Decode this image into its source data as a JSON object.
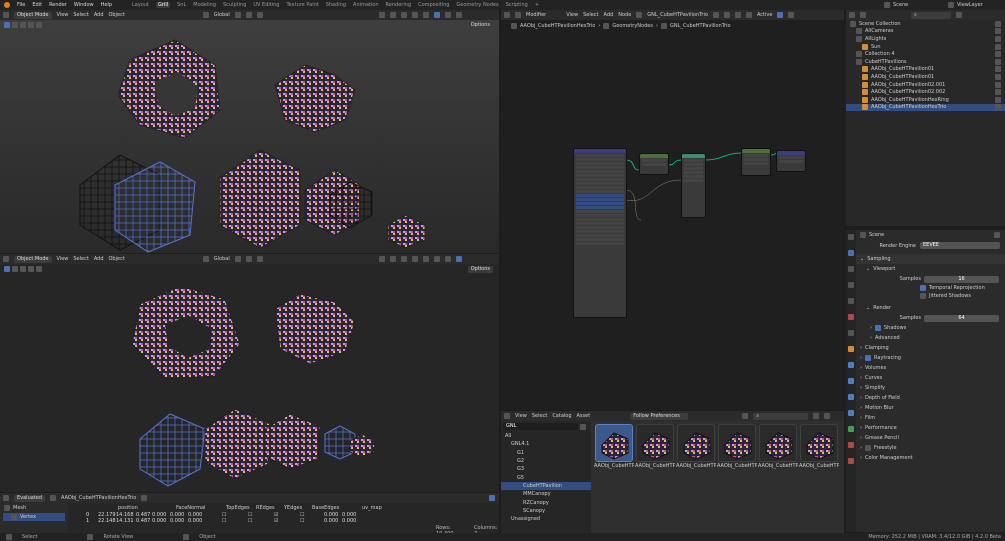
{
  "topbar": {
    "menus": [
      "File",
      "Edit",
      "Render",
      "Window",
      "Help"
    ],
    "workspaces": [
      "Layout",
      "Grill",
      "SnL",
      "Modeling",
      "Sculpting",
      "UV Editing",
      "Texture Paint",
      "Shading",
      "Animation",
      "Rendering",
      "Compositing",
      "Geometry Nodes",
      "Scripting"
    ],
    "active_workspace": "Grill",
    "scene": "Scene",
    "view_layer": "ViewLayer"
  },
  "viewport_top": {
    "mode": "Object Mode",
    "menus": [
      "View",
      "Select",
      "Add",
      "Object"
    ],
    "orientation": "Global",
    "options": "Options"
  },
  "viewport_bottom": {
    "mode": "Object Mode",
    "menus": [
      "View",
      "Select",
      "Add",
      "Object"
    ],
    "orientation": "Global",
    "options": "Options"
  },
  "node_editor": {
    "editor": "Modifier",
    "menus": [
      "View",
      "Select",
      "Add",
      "Node"
    ],
    "node_group": "GNL_CubeHTPavilionTrio",
    "active": "Active",
    "breadcrumb": [
      "AAObj_CubeHTPavilionHexTrio",
      "GeometryNodes",
      "GNL_CubeHTPavilionTrio"
    ],
    "wire_color": "#00d69d"
  },
  "outliner": {
    "rows": [
      {
        "label": "Scene Collection",
        "indent": 0,
        "sel": false
      },
      {
        "label": "AllCameras",
        "indent": 1,
        "sel": false
      },
      {
        "label": "AllLights",
        "indent": 1,
        "sel": false
      },
      {
        "label": "Sun",
        "indent": 2,
        "sel": false
      },
      {
        "label": "Collection 4",
        "indent": 1,
        "sel": false
      },
      {
        "label": "CubeHTPavilions",
        "indent": 1,
        "sel": false
      },
      {
        "label": "AAObj_CubeHTPavilion01",
        "indent": 2,
        "sel": false
      },
      {
        "label": "AAObj_CubeHTPavilion01",
        "indent": 2,
        "sel": false
      },
      {
        "label": "AAObj_CubeHTPavilion02.001",
        "indent": 2,
        "sel": false
      },
      {
        "label": "AAObj_CubeHTPavilion02.002",
        "indent": 2,
        "sel": false
      },
      {
        "label": "AAObj_CubeHTPavilionHexRing",
        "indent": 2,
        "sel": false
      },
      {
        "label": "AAObj_CubeHTPavilionHexTrio",
        "indent": 2,
        "sel": true
      }
    ]
  },
  "properties": {
    "title": "Scene",
    "render_engine_label": "Render Engine",
    "render_engine": "EEVEE",
    "sampling": "Sampling",
    "viewport": "Viewport",
    "samples_label": "Samples",
    "viewport_samples": "16",
    "temporal_reprojection": "Temporal Reprojection",
    "jittered_shadows": "Jittered Shadows",
    "render": "Render",
    "render_samples": "64",
    "sections": [
      "Shadows",
      "Advanced",
      "Clamping",
      "Raytracing",
      "Volumes",
      "Curves",
      "Simplify",
      "Depth of Field",
      "Motion Blur",
      "Film",
      "Performance",
      "Grease Pencil",
      "Freestyle",
      "Color Management"
    ]
  },
  "asset_browser": {
    "menus": [
      "View",
      "Select",
      "Catalog",
      "Asset"
    ],
    "filter": "Follow Preferences",
    "search_value": "GNL",
    "tree": [
      {
        "label": "All",
        "indent": 0,
        "sel": false
      },
      {
        "label": "GNL4.1",
        "indent": 1,
        "sel": false
      },
      {
        "label": "G1",
        "indent": 2,
        "sel": false
      },
      {
        "label": "G2",
        "indent": 2,
        "sel": false
      },
      {
        "label": "G3",
        "indent": 2,
        "sel": false
      },
      {
        "label": "G5",
        "indent": 2,
        "sel": false
      },
      {
        "label": "CubeHTPavilion",
        "indent": 3,
        "sel": true
      },
      {
        "label": "MMCanopy",
        "indent": 3,
        "sel": false
      },
      {
        "label": "RZCanopy",
        "indent": 3,
        "sel": false
      },
      {
        "label": "SCanopy",
        "indent": 3,
        "sel": false
      },
      {
        "label": "Unassigned",
        "indent": 1,
        "sel": false
      }
    ],
    "assets": [
      "AAObj_CubeHTP...",
      "AAObj_CubeHTP...",
      "AAObj_CubeHTP...",
      "AAObj_CubeHTP...",
      "AAObj_CubeHTP...",
      "AAObj_CubeHTP..."
    ]
  },
  "spreadsheet": {
    "mode": "Evaluated",
    "object": "AAObj_CubeHTPavilionHexTrio",
    "mesh": "Mesh",
    "vertex": "Vertex",
    "columns": [
      "position",
      "FaceNormal",
      "TopEdges",
      "REdges",
      "YEdges",
      "BaseEdges",
      "uv_map"
    ],
    "rows": [
      [
        "0",
        "22.179",
        "14.168",
        "0.487",
        "0.000",
        "0.000",
        "0.000",
        "",
        "",
        "",
        "",
        "0.000",
        "0.000"
      ],
      [
        "1",
        "22.148",
        "14.131",
        "0.487",
        "0.000",
        "0.000",
        "0.000",
        "",
        "",
        "",
        "",
        "0.000",
        "0.000"
      ]
    ],
    "rows_label": "Rows: 10,400",
    "cols_label": "Columns: 7"
  },
  "status": {
    "left": [
      "Select",
      "Rotate View",
      "Object"
    ],
    "right": "Memory: 252.2 MiB | VRAM: 3.4/12.0 GiB | 4.2.0 Beta"
  }
}
